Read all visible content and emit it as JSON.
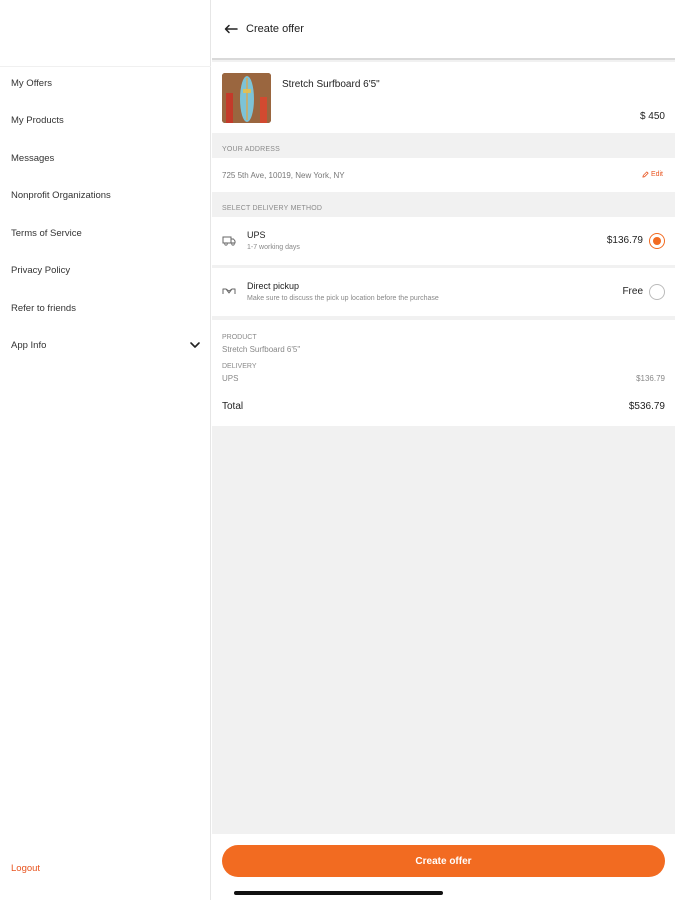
{
  "sidebar": {
    "items": [
      {
        "label": "My Offers"
      },
      {
        "label": "My Products"
      },
      {
        "label": "Messages"
      },
      {
        "label": "Nonprofit Organizations"
      },
      {
        "label": "Terms of Service"
      },
      {
        "label": "Privacy Policy"
      },
      {
        "label": "Refer to friends"
      },
      {
        "label": "App Info"
      }
    ],
    "logout_label": "Logout"
  },
  "header": {
    "title": "Create offer",
    "back_icon": "arrow-left-icon"
  },
  "product": {
    "name": "Stretch Surfboard 6'5\"",
    "price": "$ 450"
  },
  "address": {
    "section_label": "YOUR ADDRESS",
    "value": "725 5th Ave, 10019, New York, NY",
    "edit_label": "Edit"
  },
  "delivery": {
    "section_label": "SELECT DELIVERY METHOD",
    "options": [
      {
        "title": "UPS",
        "subtitle": "1-7 working days",
        "price": "$136.79",
        "selected": true,
        "icon": "truck-icon"
      },
      {
        "title": "Direct pickup",
        "subtitle": "Make sure to discuss the pick up location before the purchase",
        "price": "Free",
        "selected": false,
        "icon": "handshake-icon"
      }
    ]
  },
  "summary": {
    "product_label": "PRODUCT",
    "product_value": "Stretch Surfboard 6'5\"",
    "delivery_label": "DELIVERY",
    "delivery_value": "UPS",
    "delivery_amount": "$136.79",
    "total_label": "Total",
    "total_amount": "$536.79"
  },
  "cta": {
    "label": "Create offer"
  },
  "colors": {
    "accent": "#f26b21",
    "link": "#e8541f",
    "panel_bg": "#f1f1f1"
  }
}
